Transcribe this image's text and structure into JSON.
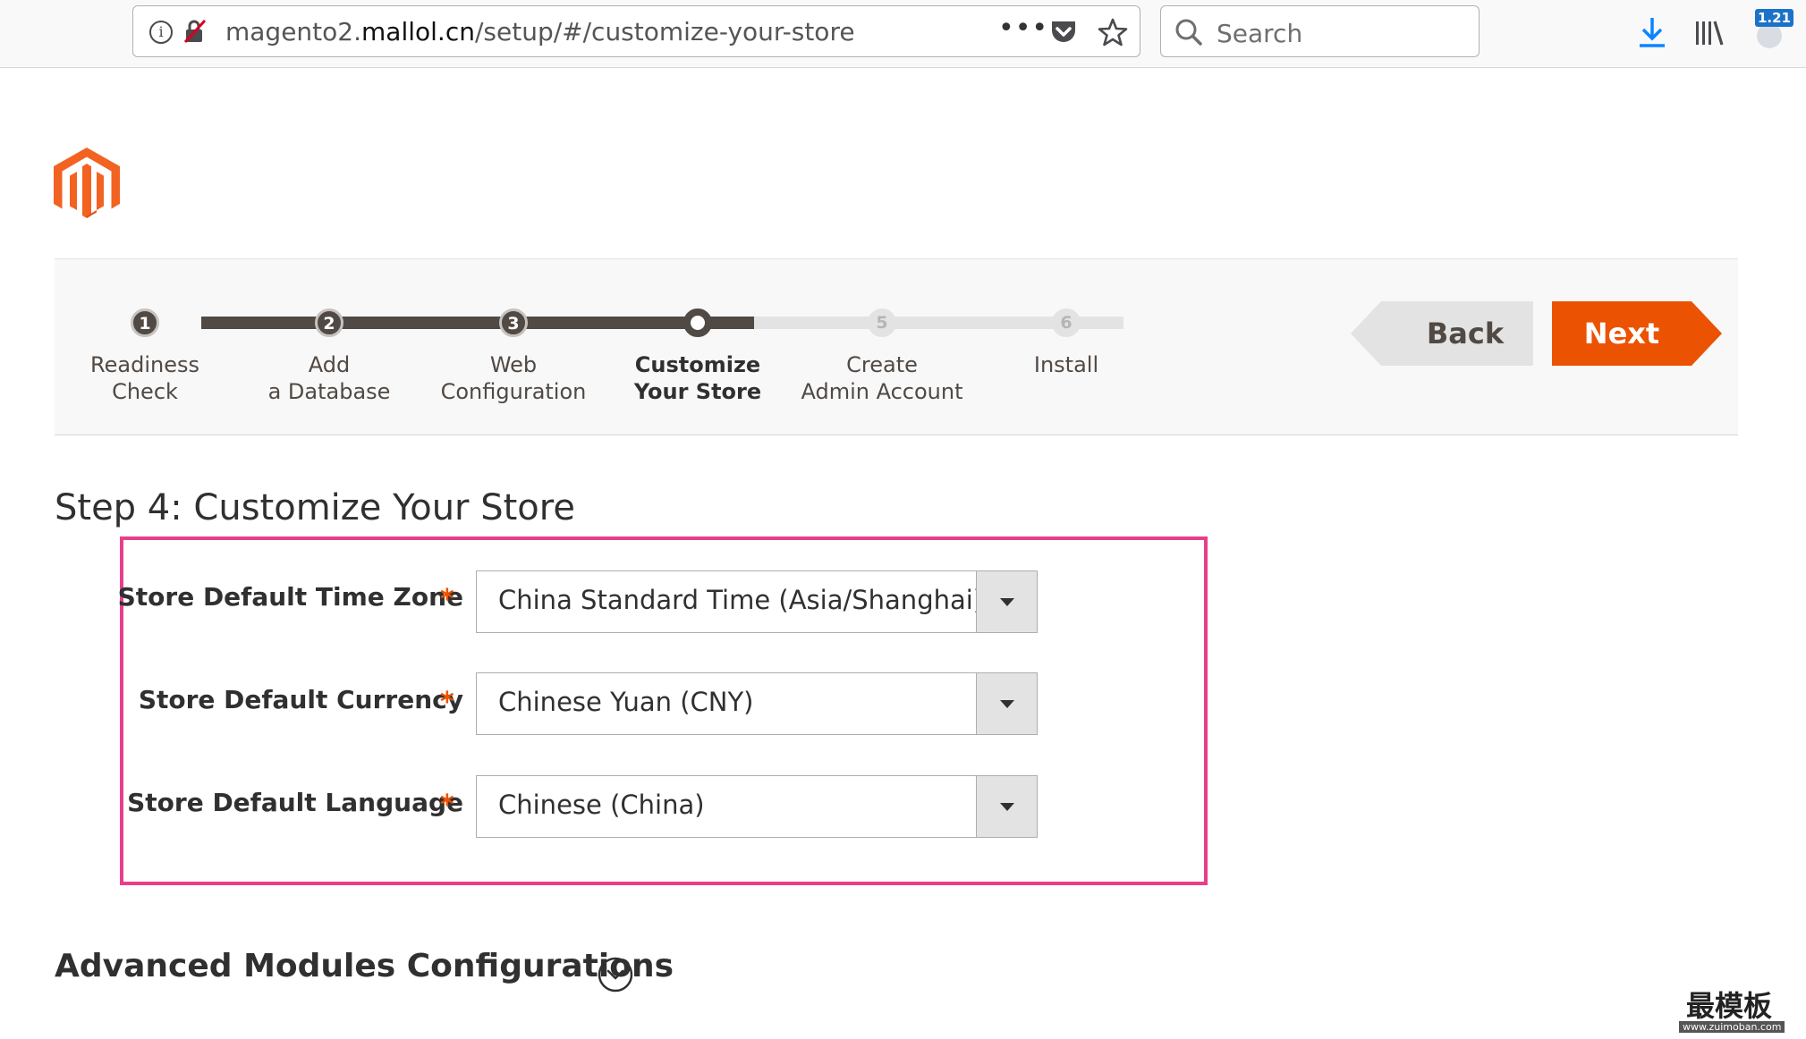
{
  "browser": {
    "url_prefix": "magento2.",
    "url_host": "mallol.cn",
    "url_path": "/setup/#/customize-your-store",
    "more_label": "•••",
    "search_placeholder": "Search",
    "extension_badge": "1.21"
  },
  "wizard": {
    "steps": [
      {
        "number": "1",
        "line1": "Readiness",
        "line2": "Check",
        "state": "done"
      },
      {
        "number": "2",
        "line1": "Add",
        "line2": "a Database",
        "state": "done"
      },
      {
        "number": "3",
        "line1": "Web",
        "line2": "Configuration",
        "state": "done"
      },
      {
        "number": "",
        "line1": "Customize",
        "line2": "Your Store",
        "state": "current"
      },
      {
        "number": "5",
        "line1": "Create",
        "line2": "Admin Account",
        "state": "todo"
      },
      {
        "number": "6",
        "line1": "Install",
        "line2": "",
        "state": "todo"
      }
    ],
    "back_label": "Back",
    "next_label": "Next"
  },
  "page": {
    "title": "Step 4: Customize Your Store",
    "required_mark": "*",
    "fields": [
      {
        "label": "Store Default Time Zone",
        "value": "China Standard Time (Asia/Shanghai)"
      },
      {
        "label": "Store Default Currency",
        "value": "Chinese Yuan (CNY)"
      },
      {
        "label": "Store Default Language",
        "value": "Chinese (China)"
      }
    ],
    "advanced_title": "Advanced Modules Configurations"
  },
  "watermark": {
    "text": "最模板",
    "url": "www.zuimoban.com"
  },
  "colors": {
    "accent": "#eb5202",
    "progress_done": "#514943",
    "progress_todo": "#e3e3e3",
    "highlight_border": "#e83e8c"
  },
  "icons": [
    "info-icon",
    "insecure-lock-icon",
    "more-icon",
    "pocket-icon",
    "bookmark-star-icon",
    "search-icon",
    "download-icon",
    "library-icon",
    "extension-icon",
    "magento-logo",
    "chevron-down-circle-icon"
  ]
}
